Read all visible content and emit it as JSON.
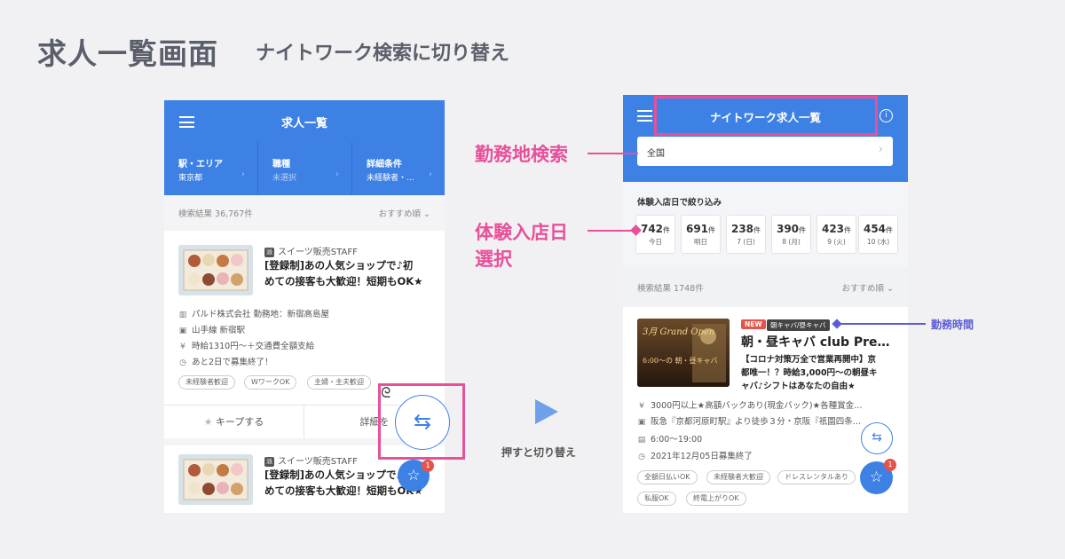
{
  "page": {
    "title": "求人一覧画面",
    "subtitle": "ナイトワーク検索に切り替え",
    "switch_caption": "押すと切り替え"
  },
  "colors": {
    "primary": "#3e81e4",
    "annotation_pink": "#e8509a",
    "annotation_indigo": "#5b5bd6",
    "new_badge": "#e5534b"
  },
  "left": {
    "header_title": "求人一覧",
    "filters": [
      {
        "label": "駅・エリア",
        "value": "東京都"
      },
      {
        "label": "職種",
        "value": "未選択"
      },
      {
        "label": "詳細条件",
        "value": "未経験者・..."
      }
    ],
    "result_count": "検索結果 36,767件",
    "sort": "おすすめ順",
    "jobs": [
      {
        "badge": "派",
        "category": "スイーツ販売STAFF",
        "title_line1": "[登録制]あの人気ショップで♪初",
        "title_line2": "めての接客も大歓迎！短期もOK★",
        "company": "パルド株式会社 勤務地：新宿高島屋",
        "station": "山手線 新宿駅",
        "wage": "時給1310円〜＋交通費全額支給",
        "deadline": "あと2日で募集終了！",
        "tags": [
          "未経験者歓迎",
          "WワークOK",
          "主婦・主夫歓迎"
        ]
      },
      {
        "badge": "派",
        "category": "スイーツ販売STAFF",
        "title_line1": "[登録制]あの人気ショップで♪初",
        "title_line2": "めての接客も大歓迎！短期もOK★"
      }
    ],
    "keep_label": "キープする",
    "detail_label": "詳細を",
    "star_badge": "1"
  },
  "right": {
    "header_title": "ナイトワーク求人一覧",
    "area_value": "全国",
    "date_filter_label": "体験入店日で絞り込み",
    "dates": [
      {
        "count": "742",
        "unit": "件",
        "day": "今日"
      },
      {
        "count": "691",
        "unit": "件",
        "day": "明日"
      },
      {
        "count": "238",
        "unit": "件",
        "day": "7 (日)"
      },
      {
        "count": "390",
        "unit": "件",
        "day": "8 (月)"
      },
      {
        "count": "423",
        "unit": "件",
        "day": "9 (火)"
      },
      {
        "count": "454",
        "unit": "件",
        "day": "10 (水)"
      }
    ],
    "result_count": "検索結果 1748件",
    "sort": "おすすめ順",
    "job": {
      "new_label": "NEW",
      "hours_tag": "朝キャバ/昼キャバ",
      "name": "朝・昼キャバ club Pre…",
      "catch_line1": "【コロナ対策万全で営業再開中】京",
      "catch_line2": "都唯一！？時給3,000円〜の朝昼キ",
      "catch_line3": "ャバ♪シフトはあなたの自由★",
      "thumb_text1": "3月 Grand Open",
      "thumb_text2": "6:00〜の 朝・昼キャバ",
      "wage": "3000円以上★高額バックあり(現金バック)★各種賞金…",
      "access": "阪急『京都河原町駅』より徒歩３分・京阪『祇園四条…",
      "hours": "6:00〜19:00",
      "deadline": "2021年12月05日募集終了",
      "tags": [
        "全額日払いOK",
        "未経験者大歓迎",
        "ドレスレンタルあり",
        "私服OK",
        "終電上がりOK"
      ]
    },
    "star_badge": "1"
  },
  "annotations": {
    "area_search": "勤務地検索",
    "trial_date_line1": "体験入店日",
    "trial_date_line2": "選択",
    "work_hours": "勤務時間"
  }
}
